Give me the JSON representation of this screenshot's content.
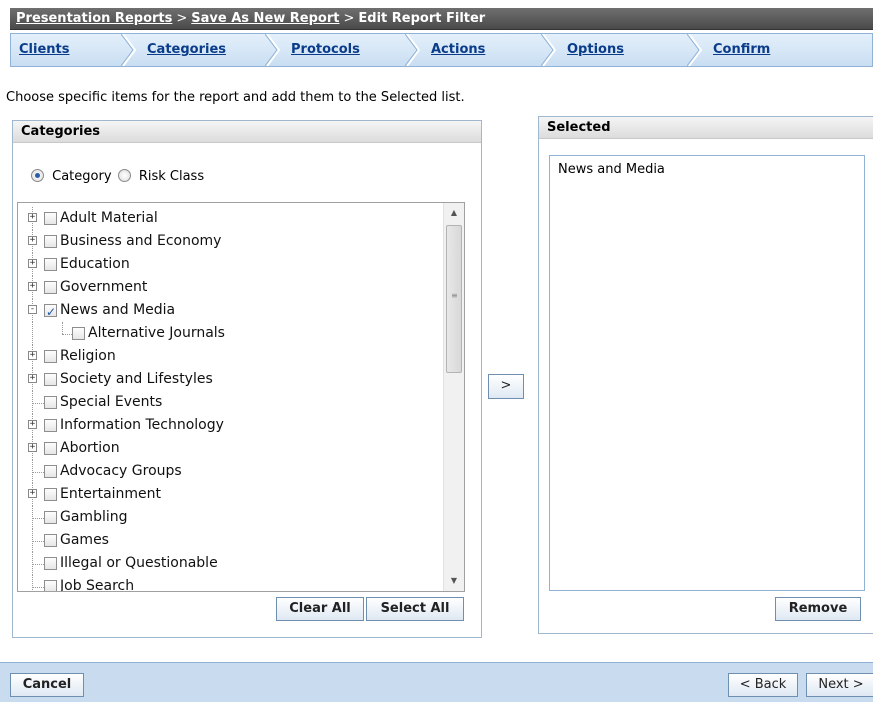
{
  "breadcrumb": {
    "items": [
      {
        "label": "Presentation Reports",
        "link": true
      },
      {
        "label": "Save As New Report",
        "link": true
      },
      {
        "label": "Edit Report Filter",
        "link": false
      }
    ],
    "separator": ">"
  },
  "steps": [
    {
      "label": "Clients"
    },
    {
      "label": "Categories"
    },
    {
      "label": "Protocols"
    },
    {
      "label": "Actions"
    },
    {
      "label": "Options"
    },
    {
      "label": "Confirm"
    }
  ],
  "instruction": "Choose specific items for the report and add them to the Selected list.",
  "categories_panel": {
    "title": "Categories",
    "radio_category": "Category",
    "radio_risk": "Risk Class",
    "selected_radio": "Category",
    "clear_all": "Clear All",
    "select_all": "Select All"
  },
  "tree": [
    {
      "label": "Adult Material",
      "expander": "+",
      "checked": false,
      "child": false
    },
    {
      "label": "Business and Economy",
      "expander": "+",
      "checked": false,
      "child": false
    },
    {
      "label": "Education",
      "expander": "+",
      "checked": false,
      "child": false
    },
    {
      "label": "Government",
      "expander": "+",
      "checked": false,
      "child": false
    },
    {
      "label": "News and Media",
      "expander": "-",
      "checked": true,
      "child": false
    },
    {
      "label": "Alternative Journals",
      "expander": "",
      "checked": false,
      "child": true
    },
    {
      "label": "Religion",
      "expander": "+",
      "checked": false,
      "child": false
    },
    {
      "label": "Society and Lifestyles",
      "expander": "+",
      "checked": false,
      "child": false
    },
    {
      "label": "Special Events",
      "expander": "",
      "checked": false,
      "child": false
    },
    {
      "label": "Information Technology",
      "expander": "+",
      "checked": false,
      "child": false
    },
    {
      "label": "Abortion",
      "expander": "+",
      "checked": false,
      "child": false
    },
    {
      "label": "Advocacy Groups",
      "expander": "",
      "checked": false,
      "child": false
    },
    {
      "label": "Entertainment",
      "expander": "+",
      "checked": false,
      "child": false
    },
    {
      "label": "Gambling",
      "expander": "",
      "checked": false,
      "child": false
    },
    {
      "label": "Games",
      "expander": "",
      "checked": false,
      "child": false
    },
    {
      "label": "Illegal or Questionable",
      "expander": "",
      "checked": false,
      "child": false
    },
    {
      "label": "Job Search",
      "expander": "",
      "checked": false,
      "child": false
    }
  ],
  "move_button": ">",
  "selected_panel": {
    "title": "Selected",
    "items": [
      "News and Media"
    ],
    "remove": "Remove"
  },
  "footer": {
    "cancel": "Cancel",
    "back": "< Back",
    "next": "Next >"
  },
  "colors": {
    "breadcrumb_bg": "#555555",
    "step_link": "#0a3c8a",
    "panel_border": "#9fb8cf",
    "footer_bg": "#c8dbef"
  }
}
